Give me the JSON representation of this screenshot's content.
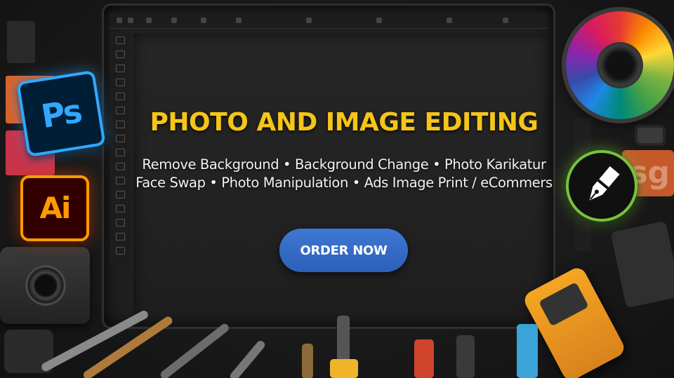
{
  "banner": {
    "title": "PHOTO AND IMAGE EDITING",
    "services_line_1": "Remove Background • Background Change • Photo Karikatur",
    "services_line_2": "Face Swap • Photo Manipulation • Ads Image Print / eCommers",
    "cta_label": "ORDER NOW"
  },
  "logos": {
    "photoshop": "Ps",
    "illustrator": "Ai",
    "side_block": "sg"
  },
  "icons": {
    "photoshop": "photoshop-logo-icon",
    "illustrator": "illustrator-logo-icon",
    "coreldraw": "coreldraw-pen-logo-icon",
    "color_wheel": "color-wheel-icon",
    "camera": "camera-icon"
  },
  "colors": {
    "title": "#f5c518",
    "button": "#2c5fb8",
    "photoshop_accent": "#31a8ff",
    "illustrator_accent": "#ff9a00",
    "coreldraw_accent": "#78c23c"
  }
}
